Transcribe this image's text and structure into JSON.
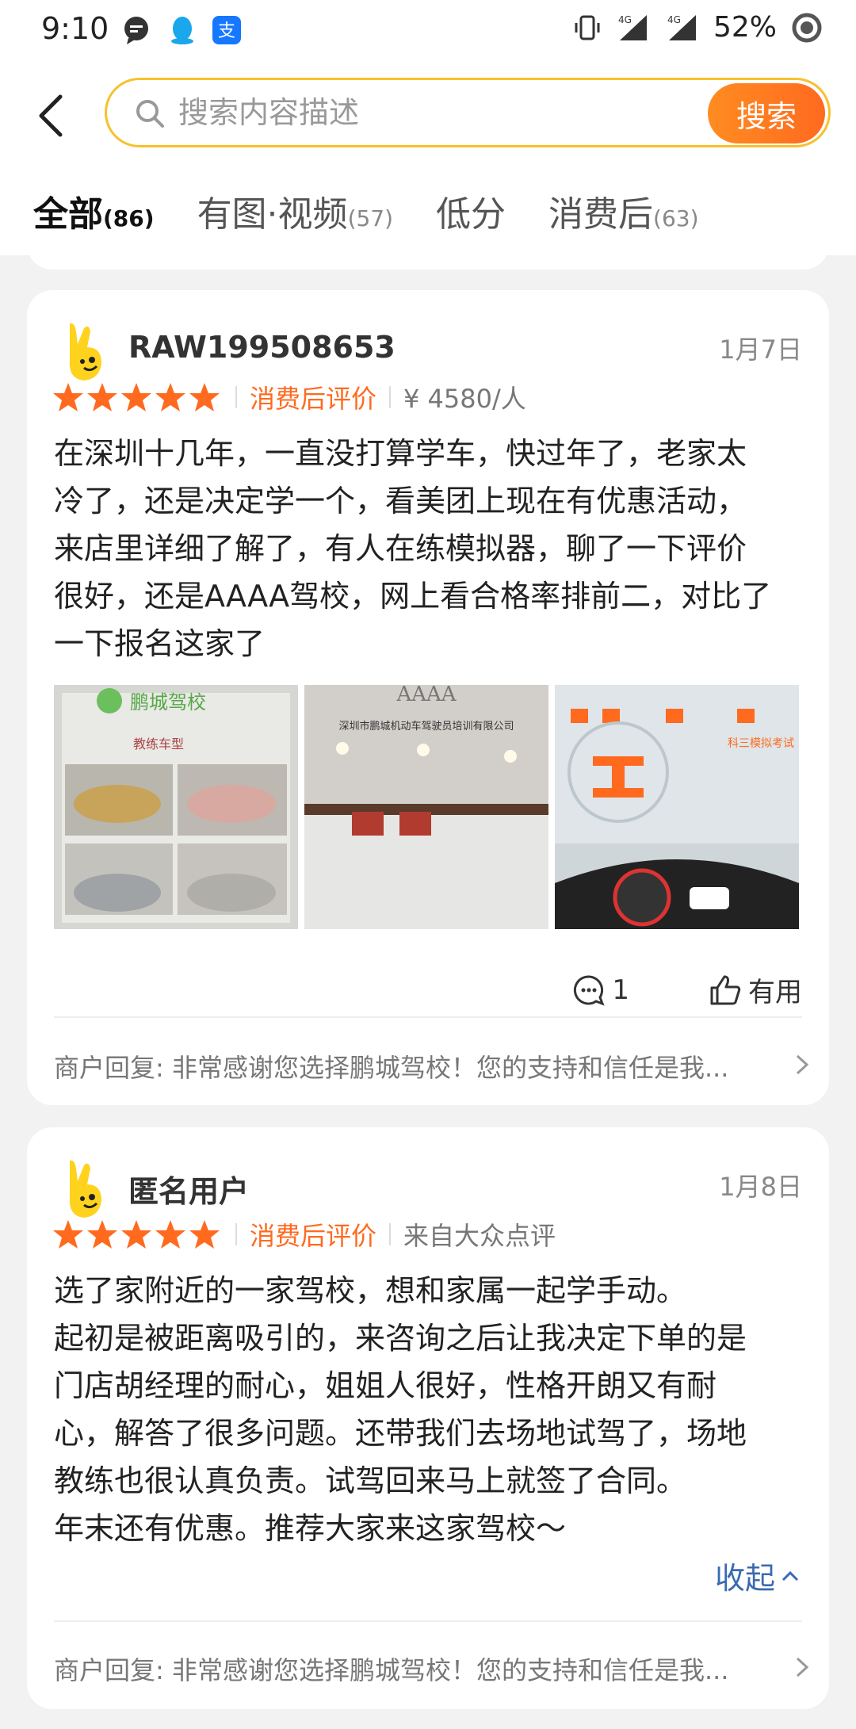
{
  "status_bar": {
    "time": "9:10",
    "battery": "52%",
    "signal_label_1": "4G",
    "signal_label_2": "4G",
    "icons": [
      "message-icon",
      "qq-icon",
      "alipay-icon",
      "vibrate-icon",
      "signal-icon",
      "signal-icon",
      "battery-icon"
    ]
  },
  "search": {
    "placeholder": "搜索内容描述",
    "button_label": "搜索"
  },
  "tabs": [
    {
      "label": "全部",
      "count": "(86)",
      "active": true
    },
    {
      "label": "有图·视频",
      "count": "(57)",
      "active": false
    },
    {
      "label": "低分",
      "count": "",
      "active": false
    },
    {
      "label": "消费后",
      "count": "(63)",
      "active": false
    }
  ],
  "reviews": [
    {
      "username": "RAW199508653",
      "date": "1月7日",
      "stars": 5,
      "tag": "消费后评价",
      "meta": "¥ 4580/人",
      "text": "在深圳十几年，一直没打算学车，快过年了，老家太\n冷了，还是决定学一个，看美团上现在有优惠活动，\n来店里详细了解了，有人在练模拟器，聊了一下评价\n很好，还是AAAA驾校，网上看合格率排前二，对比了\n一下报名这家了",
      "photos": [
        {
          "caption_logo": "鹏城驾校",
          "caption_sub": "教练车型"
        },
        {
          "caption_logo": "AAAA",
          "caption_sub": "深圳市鹏城机动车驾驶员培训有限公司"
        },
        {
          "caption_logo": "",
          "caption_sub": "科三模拟考试"
        }
      ],
      "comment_count": "1",
      "useful_label": "有用",
      "reply": "商户回复: 非常感谢您选择鹏城驾校！您的支持和信任是我..."
    },
    {
      "username": "匿名用户",
      "date": "1月8日",
      "stars": 5,
      "tag": "消费后评价",
      "meta": "来自大众点评",
      "text": "选了家附近的一家驾校，想和家属一起学手动。\n起初是被距离吸引的，来咨询之后让我决定下单的是\n门店胡经理的耐心，姐姐人很好，性格开朗又有耐\n心，解答了很多问题。还带我们去场地试驾了，场地\n教练也很认真负责。试驾回来马上就签了合同。\n年末还有优惠。推荐大家来这家驾校～",
      "collapse_label": "收起",
      "reply": "商户回复: 非常感谢您选择鹏城驾校！您的支持和信任是我..."
    }
  ],
  "colors": {
    "accent_yellow": "#f7c12e",
    "accent_orange": "#ff6a1f",
    "link_blue": "#3a6ab0"
  }
}
